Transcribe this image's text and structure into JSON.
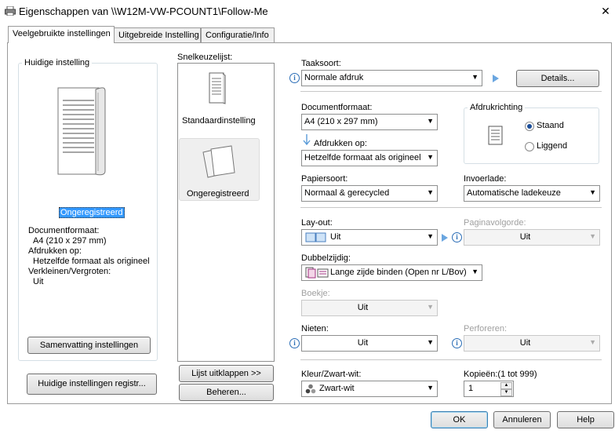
{
  "window": {
    "title": "Eigenschappen van \\\\W12M-VW-PCOUNT1\\Follow-Me",
    "close": "✕"
  },
  "tabs": [
    {
      "label": "Veelgebruikte instellingen"
    },
    {
      "label": "Uitgebreide Instelling"
    },
    {
      "label": "Configuratie/Info"
    }
  ],
  "current": {
    "group_label": "Huidige instelling",
    "profile_name": "Ongeregistreerd",
    "lines": [
      "Documentformaat:",
      "A4 (210 x 297 mm)",
      "Afdrukken op:",
      "Hetzelfde formaat als origineel",
      "Verkleinen/Vergroten:",
      "Uit"
    ],
    "summary_button": "Samenvatting instellingen",
    "register_button": "Huidige instellingen registr..."
  },
  "quick": {
    "label": "Snelkeuzelijst:",
    "items": [
      {
        "label": "Standaardinstelling"
      },
      {
        "label": "Ongeregistreerd"
      }
    ],
    "expand_button": "Lijst uitklappen >>",
    "manage_button": "Beheren..."
  },
  "settings": {
    "job_type": {
      "label": "Taaksoort:",
      "value": "Normale afdruk"
    },
    "details_button": "Details...",
    "doc_size": {
      "label": "Documentformaat:",
      "value": "A4 (210 x 297 mm)"
    },
    "print_on": {
      "label": "Afdrukken op:",
      "value": "Hetzelfde formaat als origineel"
    },
    "orientation": {
      "label": "Afdrukrichting",
      "options": [
        "Staand",
        "Liggend"
      ],
      "selected": "Staand"
    },
    "paper_type": {
      "label": "Papiersoort:",
      "value": "Normaal & gerecycled"
    },
    "tray": {
      "label": "Invoerlade:",
      "value": "Automatische ladekeuze"
    },
    "layout": {
      "label": "Lay-out:",
      "value": "Uit"
    },
    "page_order": {
      "label": "Paginavolgorde:",
      "value": "Uit"
    },
    "duplex": {
      "label": "Dubbelzijdig:",
      "value": "Lange zijde binden (Open nr L/Bov)"
    },
    "booklet": {
      "label": "Boekje:",
      "value": "Uit"
    },
    "staple": {
      "label": "Nieten:",
      "value": "Uit"
    },
    "punch": {
      "label": "Perforeren:",
      "value": "Uit"
    },
    "color": {
      "label": "Kleur/Zwart-wit:",
      "value": "Zwart-wit"
    },
    "copies": {
      "label": "Kopieën:(1 tot 999)",
      "value": "1"
    }
  },
  "footer": {
    "ok": "OK",
    "cancel": "Annuleren",
    "help": "Help"
  },
  "colors": {
    "accent": "#3c7fb1",
    "info": "#2a6db6",
    "selection": "#3399ff"
  }
}
